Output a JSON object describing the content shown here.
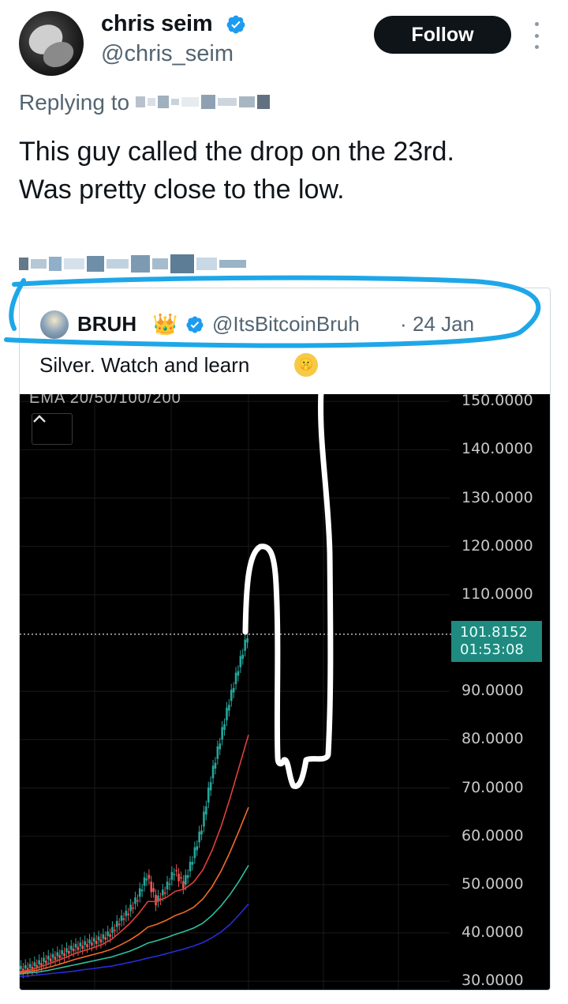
{
  "author": {
    "name": "chris seim",
    "handle": "@chris_seim",
    "verified": true,
    "follow_label": "Follow"
  },
  "reply": {
    "label": "Replying to"
  },
  "tweet": {
    "line1": "This guy called the drop on the 23rd.",
    "line2": "Was pretty close to the low."
  },
  "quoted": {
    "name": "BRUH",
    "crown": "👑",
    "handle": "@ItsBitcoinBruh",
    "separator": "·",
    "date": "24 Jan",
    "text": "Silver. Watch and learn",
    "emoji_icon": "shushing-face-icon"
  },
  "colors": {
    "verified_blue": "#1d9bf0",
    "highlight_cyan": "#1ea7e8",
    "price_tag": "#1e8a80",
    "chart_bg": "#000000"
  },
  "chart_data": {
    "type": "line",
    "title": "",
    "ema_label": "EMA 20/50/100/200",
    "price_label": "101.8152",
    "countdown": "01:53:08",
    "ylim": [
      30,
      150
    ],
    "y_ticks": [
      "150.0000",
      "140.0000",
      "130.0000",
      "120.0000",
      "110.0000",
      "90.0000",
      "80.0000",
      "70.0000",
      "60.0000",
      "50.0000",
      "40.0000",
      "30.0000"
    ],
    "current_price": 101.8152,
    "series": [
      {
        "name": "price",
        "values": [
          32.5,
          32.8,
          33.5,
          34.5,
          35.2,
          36.0,
          37.0,
          37.5,
          38.2,
          38.8,
          40.0,
          42.5,
          44.5,
          47.5,
          52.0,
          46.5,
          49.0,
          53.0,
          50.0,
          55.5,
          62.0,
          72.0,
          80.0,
          88.0,
          95.0,
          101.8
        ]
      },
      {
        "name": "EMA 20",
        "values": [
          32.0,
          32.3,
          32.8,
          33.5,
          34.2,
          34.9,
          35.7,
          36.3,
          36.9,
          37.6,
          38.6,
          40.2,
          41.9,
          44.0,
          46.5,
          46.5,
          47.3,
          48.6,
          49.1,
          50.5,
          53.0,
          57.0,
          62.0,
          68.0,
          74.5,
          81.0
        ]
      },
      {
        "name": "EMA 50",
        "values": [
          31.8,
          32.0,
          32.3,
          32.8,
          33.3,
          33.9,
          34.5,
          35.0,
          35.5,
          36.0,
          36.6,
          37.5,
          38.5,
          39.7,
          41.2,
          41.8,
          42.6,
          43.6,
          44.3,
          45.3,
          47.0,
          49.5,
          52.8,
          56.8,
          61.3,
          66.0
        ]
      },
      {
        "name": "EMA 100",
        "values": [
          31.5,
          31.7,
          31.9,
          32.2,
          32.6,
          33.0,
          33.4,
          33.8,
          34.2,
          34.6,
          35.0,
          35.6,
          36.2,
          37.0,
          37.9,
          38.4,
          39.0,
          39.7,
          40.3,
          41.0,
          42.0,
          43.6,
          45.6,
          48.0,
          50.8,
          54.0
        ]
      },
      {
        "name": "EMA 200",
        "values": [
          31.0,
          31.1,
          31.3,
          31.5,
          31.7,
          31.9,
          32.1,
          32.4,
          32.6,
          32.9,
          33.1,
          33.5,
          33.9,
          34.3,
          34.8,
          35.2,
          35.7,
          36.2,
          36.7,
          37.3,
          38.0,
          39.0,
          40.2,
          41.8,
          43.8,
          46.0
        ]
      }
    ],
    "series_colors": [
      "#26a69a",
      "#e0403a",
      "#f06b2a",
      "#2fbf9f",
      "#2a2bd9"
    ],
    "grid": true
  }
}
